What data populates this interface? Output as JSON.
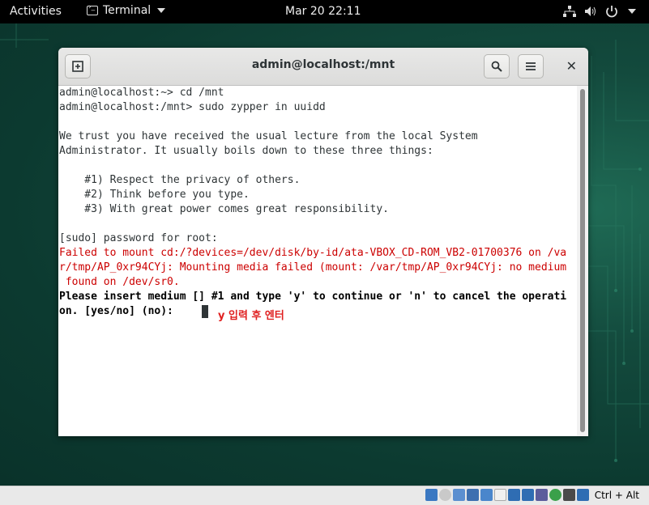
{
  "topbar": {
    "activities": "Activities",
    "app_name": "Terminal",
    "clock": "Mar 20  22:11"
  },
  "window": {
    "title": "admin@localhost:/mnt"
  },
  "terminal": {
    "lines": {
      "l1": "admin@localhost:~> cd /mnt",
      "l2": "admin@localhost:/mnt> sudo zypper in uuidd",
      "l3": "We trust you have received the usual lecture from the local System",
      "l4": "Administrator. It usually boils down to these three things:",
      "l5": "    #1) Respect the privacy of others.",
      "l6": "    #2) Think before you type.",
      "l7": "    #3) With great power comes great responsibility.",
      "l8": "[sudo] password for root:",
      "e1": "Failed to mount cd:/?devices=/dev/disk/by-id/ata-VBOX_CD-ROM_VB2-01700376 on /va",
      "e2": "r/tmp/AP_0xr94CYj: Mounting media failed (mount: /var/tmp/AP_0xr94CYj: no medium",
      "e3": " found on /dev/sr0.",
      "p1": "Please insert medium [] #1 and type 'y' to continue or 'n' to cancel the operati",
      "p2": "on. [yes/no] (no): "
    },
    "annotation": "y 입력 후 엔터"
  },
  "statusbar": {
    "host_key": "Ctrl + Alt"
  },
  "colors": {
    "error_text": "#cc0000",
    "annotation": "#e02020"
  }
}
